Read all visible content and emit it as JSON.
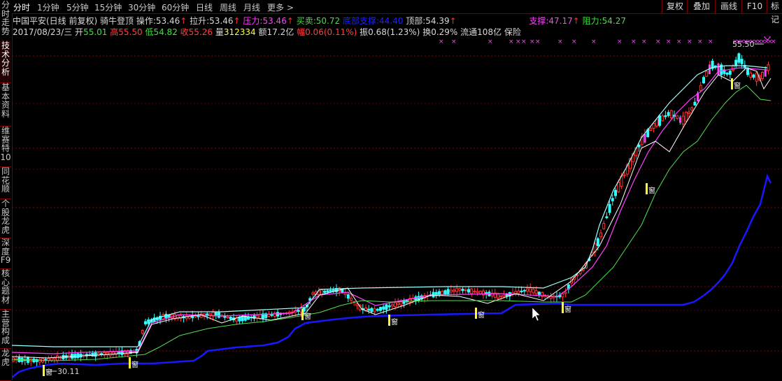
{
  "sidebar": {
    "tabs": [
      {
        "label": "分时走势"
      },
      {
        "label": "技术分析"
      },
      {
        "label": "基本资料"
      },
      {
        "label": "维赛特10"
      },
      {
        "label": "同花顺"
      },
      {
        "label": "个股龙虎"
      },
      {
        "label": "深度F9"
      },
      {
        "label": "核心题材"
      },
      {
        "label": "主营构成"
      },
      {
        "label": "龙虎"
      }
    ]
  },
  "toolbar": {
    "periods": [
      "分时",
      "1分钟",
      "5分钟",
      "15分钟",
      "30分钟",
      "60分钟",
      "日线",
      "周线",
      "月线",
      "更多 >"
    ],
    "right": [
      "复权",
      "叠加",
      "画线",
      "F10",
      "标记"
    ]
  },
  "info": {
    "title": "中国平安(日线 前复权) 骑牛登顶",
    "op_label": "操作:",
    "op_value": "53.46",
    "lift_label": "拉升:",
    "lift_value": "53.46",
    "pressure_label": "压力:",
    "pressure_value": "53.46",
    "trade_label": "买卖:",
    "trade_value": "50.72",
    "bottom_label": "底部支撑:",
    "bottom_value": "44.40",
    "top_label": "顶部:",
    "top_value": "54.39",
    "support_label": "支撑:",
    "support_value": "47.17",
    "resist_label": "阻力:",
    "resist_value": "54.27",
    "date": "2017/08/23/三",
    "open_label": "开",
    "open_value": "55.01",
    "high_label": "高",
    "high_value": "55.50",
    "low_label": "低",
    "low_value": "54.82",
    "close_label": "收",
    "close_value": "55.26",
    "vol_label": "量",
    "vol_value": "312334",
    "amt_label": "额",
    "amt_value": "17.2亿",
    "chg_label": "幅",
    "chg_value": "0.06(0.11%)",
    "amp_label": "振",
    "amp_value": "0.68(1.23%)",
    "turn_label": "换",
    "turn_value": "0.29%",
    "float_label": "流通",
    "float_value": "108亿",
    "extra": "保险"
  },
  "annotations": {
    "max_price": "55.50",
    "min_price": "30.11",
    "marker": "窗"
  },
  "colors": {
    "up": "#ff3333",
    "down": "#30ffff",
    "support": "#1818ff",
    "trail": "#50e050",
    "white": "#ffffff",
    "magenta": "#ff40ff",
    "grid": "#8a0000"
  }
}
